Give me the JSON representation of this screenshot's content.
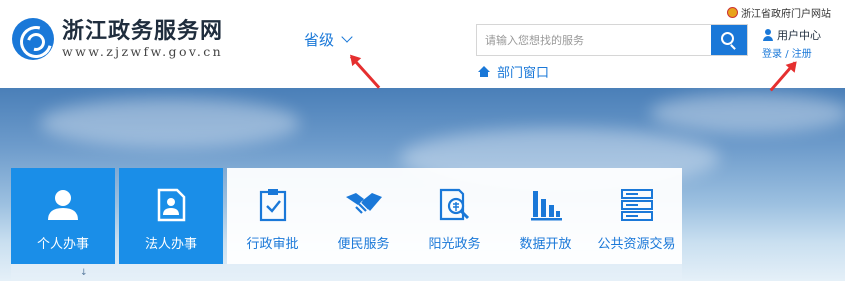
{
  "header": {
    "site_title": "浙江政务服务网",
    "site_domain": "www.zjzwfw.gov.cn",
    "level_label": "省级",
    "search_placeholder": "请输入您想找的服务",
    "dept_label": "部门窗口",
    "gov_link": "浙江省政府门户网站",
    "user_center": "用户中心",
    "login": "登录",
    "separator": "/",
    "register": "注册"
  },
  "services": {
    "primary": [
      {
        "label": "个人办事",
        "icon": "person-icon"
      },
      {
        "label": "法人办事",
        "icon": "corporate-document-icon"
      }
    ],
    "secondary": [
      {
        "label": "行政审批",
        "icon": "clipboard-check-icon"
      },
      {
        "label": "便民服务",
        "icon": "handshake-icon"
      },
      {
        "label": "阳光政务",
        "icon": "document-magnify-icon"
      },
      {
        "label": "数据开放",
        "icon": "bar-chart-icon"
      },
      {
        "label": "公共资源交易",
        "icon": "server-stack-icon"
      }
    ]
  },
  "colors": {
    "brand_blue": "#1a78d8",
    "tile_blue": "#1a8ee8",
    "annotation_red": "#e52f2f"
  }
}
